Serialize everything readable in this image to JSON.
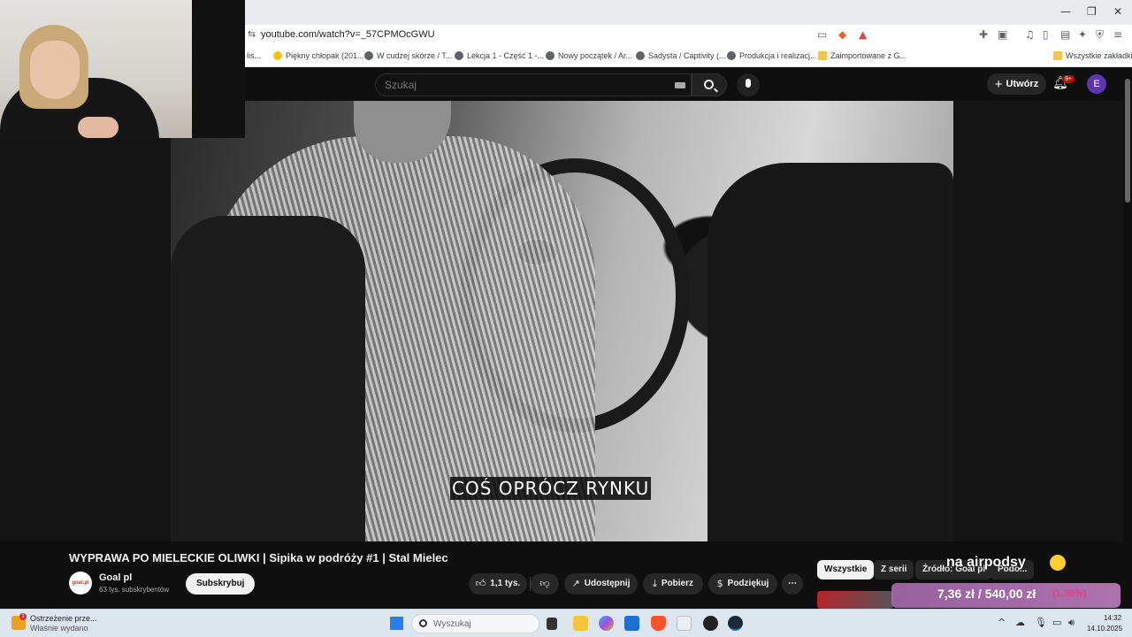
{
  "browser": {
    "url": "youtube.com/watch?v=_57CPMOcGWU",
    "bookmarks": [
      {
        "label": "lis...",
        "icon": "page-icon"
      },
      {
        "label": "Piękny chłopak (201...",
        "icon": "emoji-icon"
      },
      {
        "label": "W cudzej skórze / T...",
        "icon": "globe-icon"
      },
      {
        "label": "Lekcja 1 - Część 1 -...",
        "icon": "globe-icon"
      },
      {
        "label": "Nowy początek / Ar...",
        "icon": "globe-icon"
      },
      {
        "label": "Sadysta / Captivity (...",
        "icon": "globe-icon"
      },
      {
        "label": "Produkcja i realizacj...",
        "icon": "globe-icon"
      },
      {
        "label": "Zaimportowane z G...",
        "icon": "folder-icon"
      }
    ],
    "all_bookmarks_label": "Wszystkie zakładki"
  },
  "youtube": {
    "search_placeholder": "Szukaj",
    "create_label": "Utwórz",
    "notification_count": "9+",
    "avatar_letter": "E",
    "subtitle": "COŚ OPRÓCZ RYNKU",
    "video_title": "WYPRAWA PO MIELECKIE OLIWKI | Sipika w podróży #1 | Stal Mielec",
    "channel": {
      "name": "Goal pl",
      "subscribers": "63 tys. subskrybentów",
      "avatar_text": "goal.pl",
      "subscribe_label": "Subskrybuj"
    },
    "actions": {
      "likes": "1,1 tys.",
      "share": "Udostępnij",
      "download": "Pobierz",
      "thanks": "Podziękuj",
      "more": "⋯"
    },
    "chips": [
      "Wszystkie",
      "Z serii",
      "Źródło: Goal pl",
      "Podo..."
    ]
  },
  "stream_overlay": {
    "text": "na airpodsy",
    "price": "7,36 zł / 540,00 zł",
    "percent": "(1,36%)"
  },
  "taskbar": {
    "notification_title": "Ostrzeżenie prze...",
    "notification_sub": "Właśnie wydano",
    "notification_badge": "1",
    "search_placeholder": "Wyszukaj",
    "time": "14:32",
    "date": "14.10.2025"
  },
  "colors": {
    "yt_background": "#0f0f0f",
    "notif_red": "#cc0000",
    "avatar_purple": "#5e35b1",
    "overlay_pink": "#c884c8"
  }
}
